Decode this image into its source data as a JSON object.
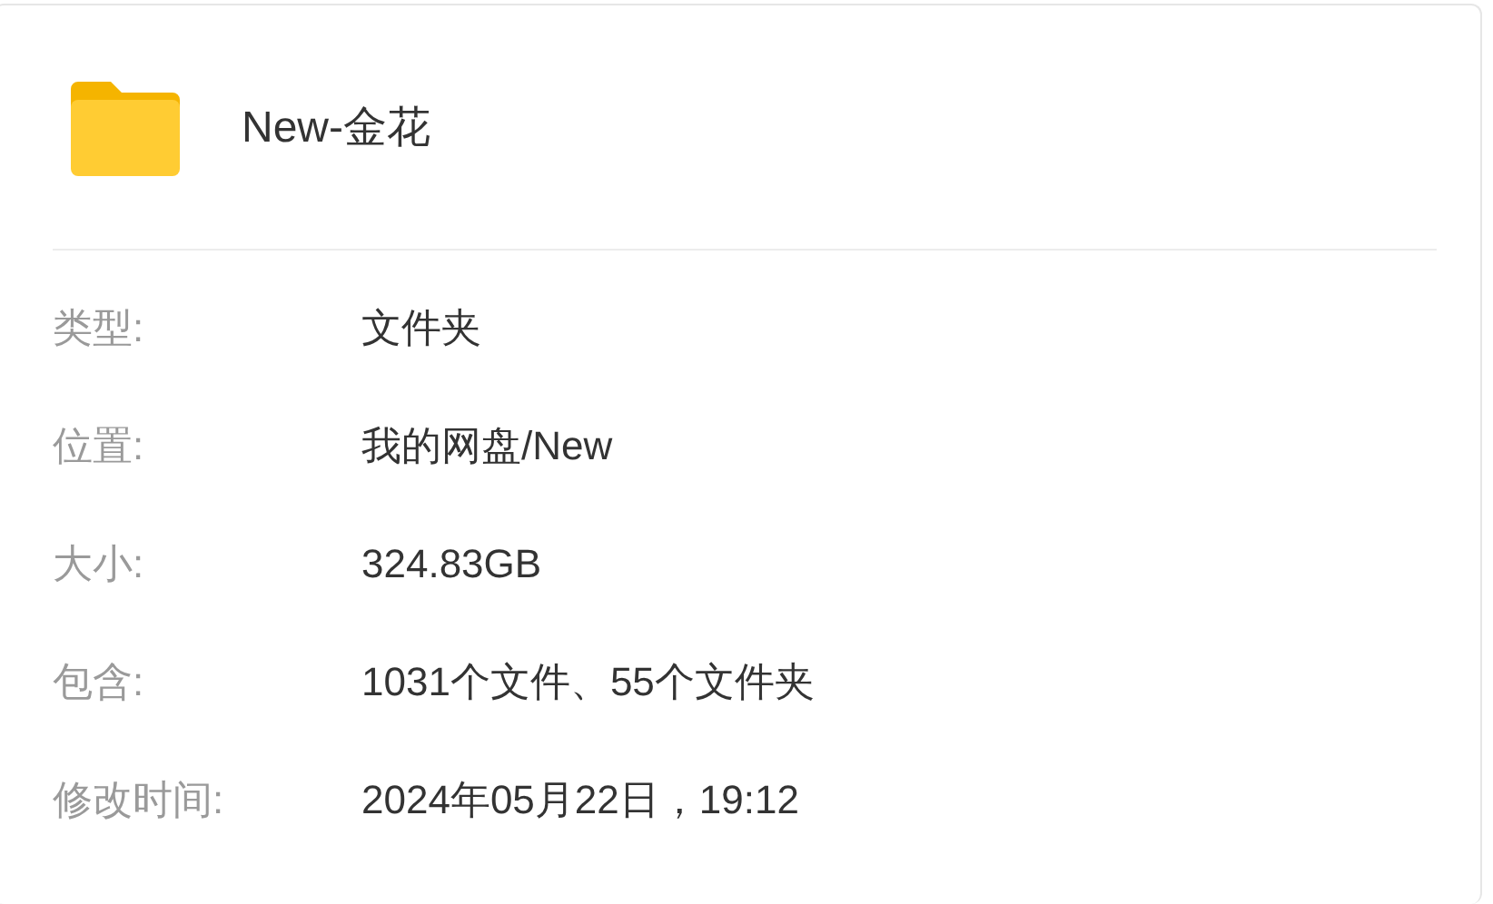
{
  "title": "New-金花",
  "properties": [
    {
      "label": "类型:",
      "value": "文件夹"
    },
    {
      "label": "位置:",
      "value": "我的网盘/New"
    },
    {
      "label": "大小:",
      "value": "324.83GB"
    },
    {
      "label": "包含:",
      "value": "1031个文件、55个文件夹"
    },
    {
      "label": "修改时间:",
      "value": "2024年05月22日，19:12"
    }
  ]
}
